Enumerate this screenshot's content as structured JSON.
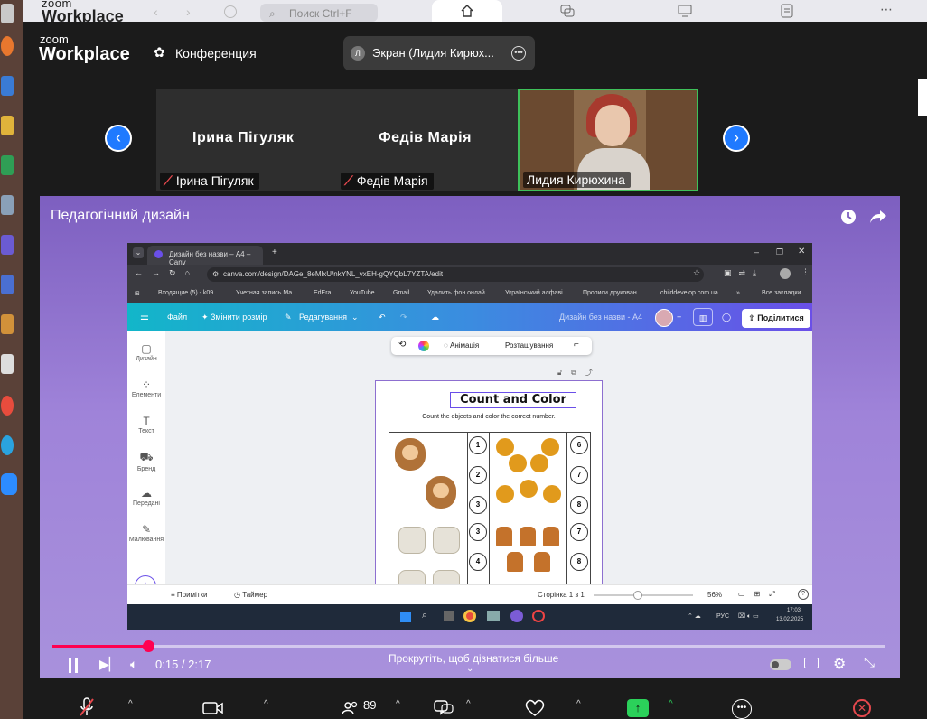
{
  "topbar": {
    "logo_top": "zoom",
    "logo_bottom": "Workplace",
    "search_placeholder": "Поиск Ctrl+F"
  },
  "header": {
    "brand_top": "zoom",
    "brand_bottom": "Workplace",
    "conference_label": "Конференция",
    "screen_avatar": "Л",
    "screen_label": "Экран (Лидия Кирюх..."
  },
  "participants": [
    {
      "name": "Ірина Пігуляк",
      "caption": "Ірина Пігуляк"
    },
    {
      "name": "Федів Марія",
      "caption": "Федів Марія"
    },
    {
      "name": "",
      "caption": "Лидия Кирюхина"
    }
  ],
  "share": {
    "title": "Педагогічний дизайн"
  },
  "inner_browser": {
    "tab_title": "Дизайн без назви – A4 – Canv",
    "url": "canva.com/design/DAGe_8eMlxU/nkYNL_vxEH-gQYQbL7YZTA/edit",
    "bookmarks": [
      "Входящие (5) - k09...",
      "Учетная запись Ма...",
      "EdEra",
      "YouTube",
      "Gmail",
      "Удалить фон онлай...",
      "Український алфаві...",
      "Прописи друкован...",
      "childdevelop.com.ua",
      "Все закладки"
    ]
  },
  "canva": {
    "menu_file": "Файл",
    "resize": "Змінити розмір",
    "edit": "Редагування",
    "doc_title": "Дизайн без назви - А4",
    "share_btn": "Поділитися",
    "sidebar": [
      "Дизайн",
      "Елементи",
      "Текст",
      "Бренд",
      "Передані",
      "Малювання"
    ],
    "float_animation": "Анімація",
    "float_arrange": "Розташування",
    "worksheet_title": "Count and Color",
    "worksheet_instruction": "Count the objects and color the correct number.",
    "row1_left": [
      "1",
      "2",
      "3"
    ],
    "row1_right": [
      "6",
      "7",
      "8"
    ],
    "row2_left": [
      "3",
      "4"
    ],
    "row2_right": [
      "7",
      "8"
    ],
    "notes": "Примітки",
    "timer": "Таймер",
    "page_indicator": "Сторінка 1 з 1",
    "zoom_level": "56%"
  },
  "win_taskbar": {
    "lang": "РУС",
    "time": "17:03",
    "date": "13.02.2025"
  },
  "player": {
    "progress": 0.115,
    "time": "0:15 / 2:17",
    "scroll_hint": "Прокрутіть, щоб дізнатися більше"
  },
  "toolbar": {
    "participants_count": "89"
  },
  "colors": {
    "accent_blue": "#1f7aff",
    "progress_red": "#ff0050",
    "active_speaker_border": "#3ec15a",
    "share_green": "#2bd15a",
    "end_red": "#e5484d"
  }
}
